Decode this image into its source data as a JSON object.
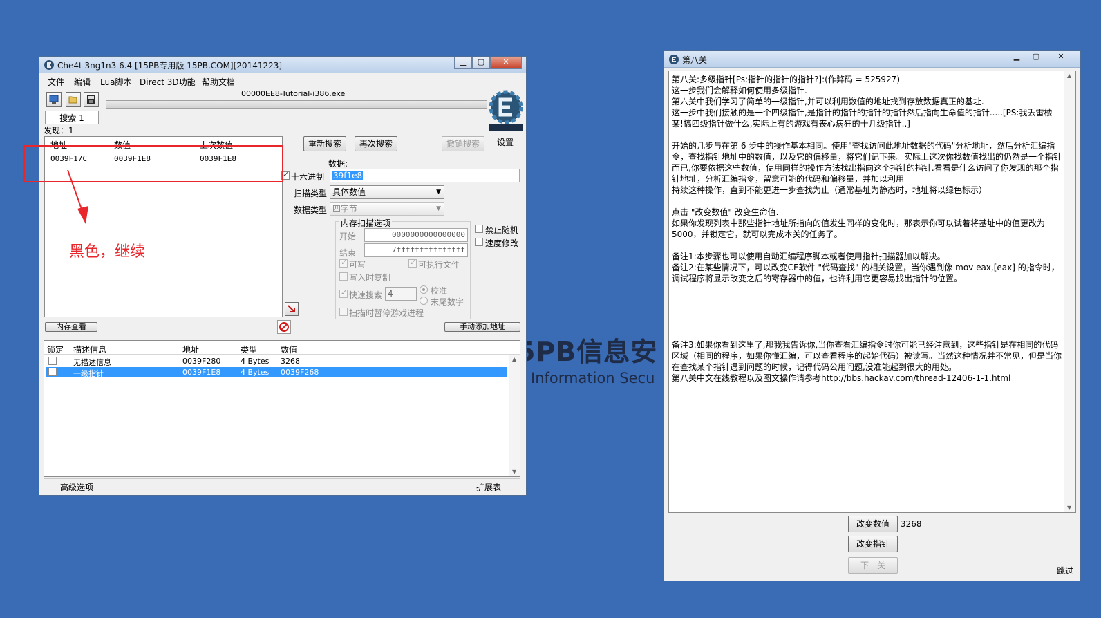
{
  "watermark": {
    "line1": "5PB信息安",
    "line2": "3 Information Secu"
  },
  "annotation": {
    "text": "黑色，继续"
  },
  "ce": {
    "title": "Che4t 3ng1n3 6.4 [15PB专用版 15PB.COM][20141223]",
    "menu": [
      "文件",
      "编辑",
      "Lua脚本",
      "Direct 3D功能",
      "帮助文档"
    ],
    "process_name": "00000EE8-Tutorial-i386.exe",
    "tab_label": "搜索 1",
    "found_label": "发现：1",
    "settings_label": "设置",
    "results": {
      "headers": [
        "地址",
        "数值",
        "上次数值"
      ],
      "rows": [
        {
          "address": "0039F17C",
          "value": "0039F1E8",
          "previous": "0039F1E8"
        }
      ]
    },
    "buttons": {
      "new_scan": "重新搜索",
      "next_scan": "再次搜索",
      "undo_scan": "撤销搜索",
      "memory_view": "内存查看",
      "add_manual": "手动添加地址"
    },
    "value_label": "数据:",
    "hex_label": "十六进制",
    "hex_checked": true,
    "value_input": "39f1e8",
    "scan_type_label": "扫描类型",
    "scan_type_value": "具体数值",
    "value_type_label": "数据类型",
    "value_type_value": "四字节",
    "mem_options": {
      "group_label": "内存扫描选项",
      "start_label": "开始",
      "start_value": "0000000000000000",
      "end_label": "结束",
      "end_value": "7fffffffffffffff",
      "writable": "可写",
      "executable": "可执行文件",
      "copy_on_write": "写入时复制",
      "fast_scan": "快速搜索",
      "fast_scan_value": "4",
      "alignment": "校准",
      "last_digits": "末尾数字",
      "pause_game": "扫描时暂停游戏进程"
    },
    "no_random": "禁止随机",
    "speedhack": "速度修改",
    "address_list": {
      "headers": [
        "锁定",
        "描述信息",
        "地址",
        "类型",
        "数值"
      ],
      "rows": [
        {
          "desc": "无描述信息",
          "address": "0039F280",
          "type": "4 Bytes",
          "value": "3268"
        },
        {
          "desc": "一级指针",
          "address": "0039F1E8",
          "type": "4 Bytes",
          "value": "0039F268"
        }
      ]
    },
    "advanced_options": "高级选项",
    "table_extras": "扩展表"
  },
  "tutorial": {
    "title": "第八关",
    "paragraphs": [
      "第八关:多级指针[Ps:指针的指针的指针?]:(作弊码 = 525927)\n这一步我们会解释如何使用多级指针.\n第六关中我们学习了简单的一级指针,并可以利用数值的地址找到存放数据真正的基址.\n这一步中我们接触的是一个四级指针,是指针的指针的指针的指针然后指向生命值的指针.....[PS:我丢雷楼某!搞四级指针做什么,实际上有的游戏有丧心病狂的十几级指针..]",
      "开始的几步与在第 6 步中的操作基本相同。使用\"查找访问此地址数据的代码\"分析地址，然后分析汇编指令，查找指针地址中的数值，以及它的偏移量，将它们记下来。实际上这次你找数值找出的仍然是一个指针而已,你要依据这些数值，使用同样的操作方法找出指向这个指针的指针.看看是什么访问了你发现的那个指针地址，分析汇编指令，留意可能的代码和偏移量，并加以利用\n持续这种操作，直到不能更进一步查找为止（通常基址为静态时，地址将以绿色标示）",
      "点击 \"改变数值\" 改变生命值.\n如果你发现列表中那些指针地址所指向的值发生同样的变化时，那表示你可以试着将基址中的值更改为 5000，并锁定它，就可以完成本关的任务了。",
      "备注1:本步骤也可以使用自动汇编程序脚本或者使用指针扫描器加以解决。\n备注2:在某些情况下，可以改变CE软件 \"代码查找\" 的相关设置，当你遇到像 mov eax,[eax] 的指令时，调试程序将显示改变之后的寄存器中的值，也许利用它更容易找出指针的位置。",
      "备注3:如果你看到这里了,那我我告诉你,当你查看汇编指令时你可能已经注意到，这些指针是在相同的代码区域（相同的程序，如果你懂汇编，可以查看程序的起始代码）被读写。当然这种情况并不常见，但是当你在查找某个指针遇到问题的时候，记得代码公用问题,没准能起到很大的用处。\n第八关中文在线教程以及图文操作请参考http://bbs.hackav.com/thread-12406-1-1.html"
    ],
    "change_value_btn": "改变数值",
    "health_value": "3268",
    "change_pointer_btn": "改变指针",
    "next_btn": "下一关",
    "skip_link": "跳过"
  }
}
